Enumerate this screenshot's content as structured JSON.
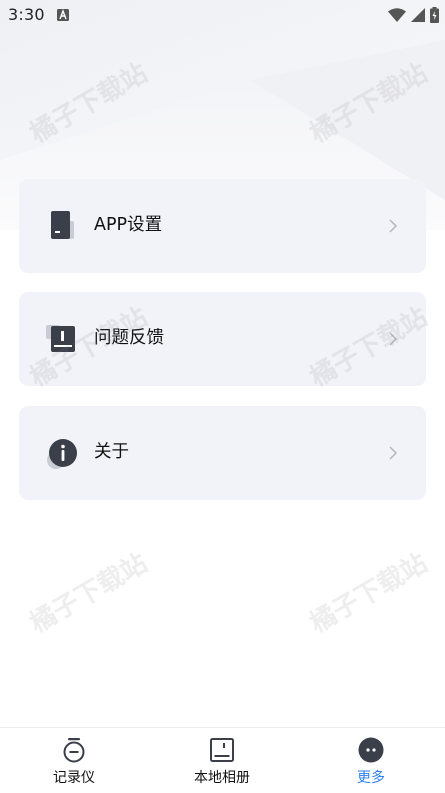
{
  "status_bar": {
    "time": "3:30"
  },
  "watermark": "橘子下载站",
  "menu": [
    {
      "label": "APP设置",
      "icon": "phone-settings-icon"
    },
    {
      "label": "问题反馈",
      "icon": "feedback-icon"
    },
    {
      "label": "关于",
      "icon": "info-icon"
    }
  ],
  "bottom_nav": [
    {
      "label": "记录仪",
      "icon": "recorder-icon",
      "active": false
    },
    {
      "label": "本地相册",
      "icon": "album-icon",
      "active": false
    },
    {
      "label": "更多",
      "icon": "more-icon",
      "active": true
    }
  ],
  "colors": {
    "card_bg": "#f1f3f9",
    "icon_dark": "#3b3f4a",
    "active": "#2d7ff0"
  }
}
